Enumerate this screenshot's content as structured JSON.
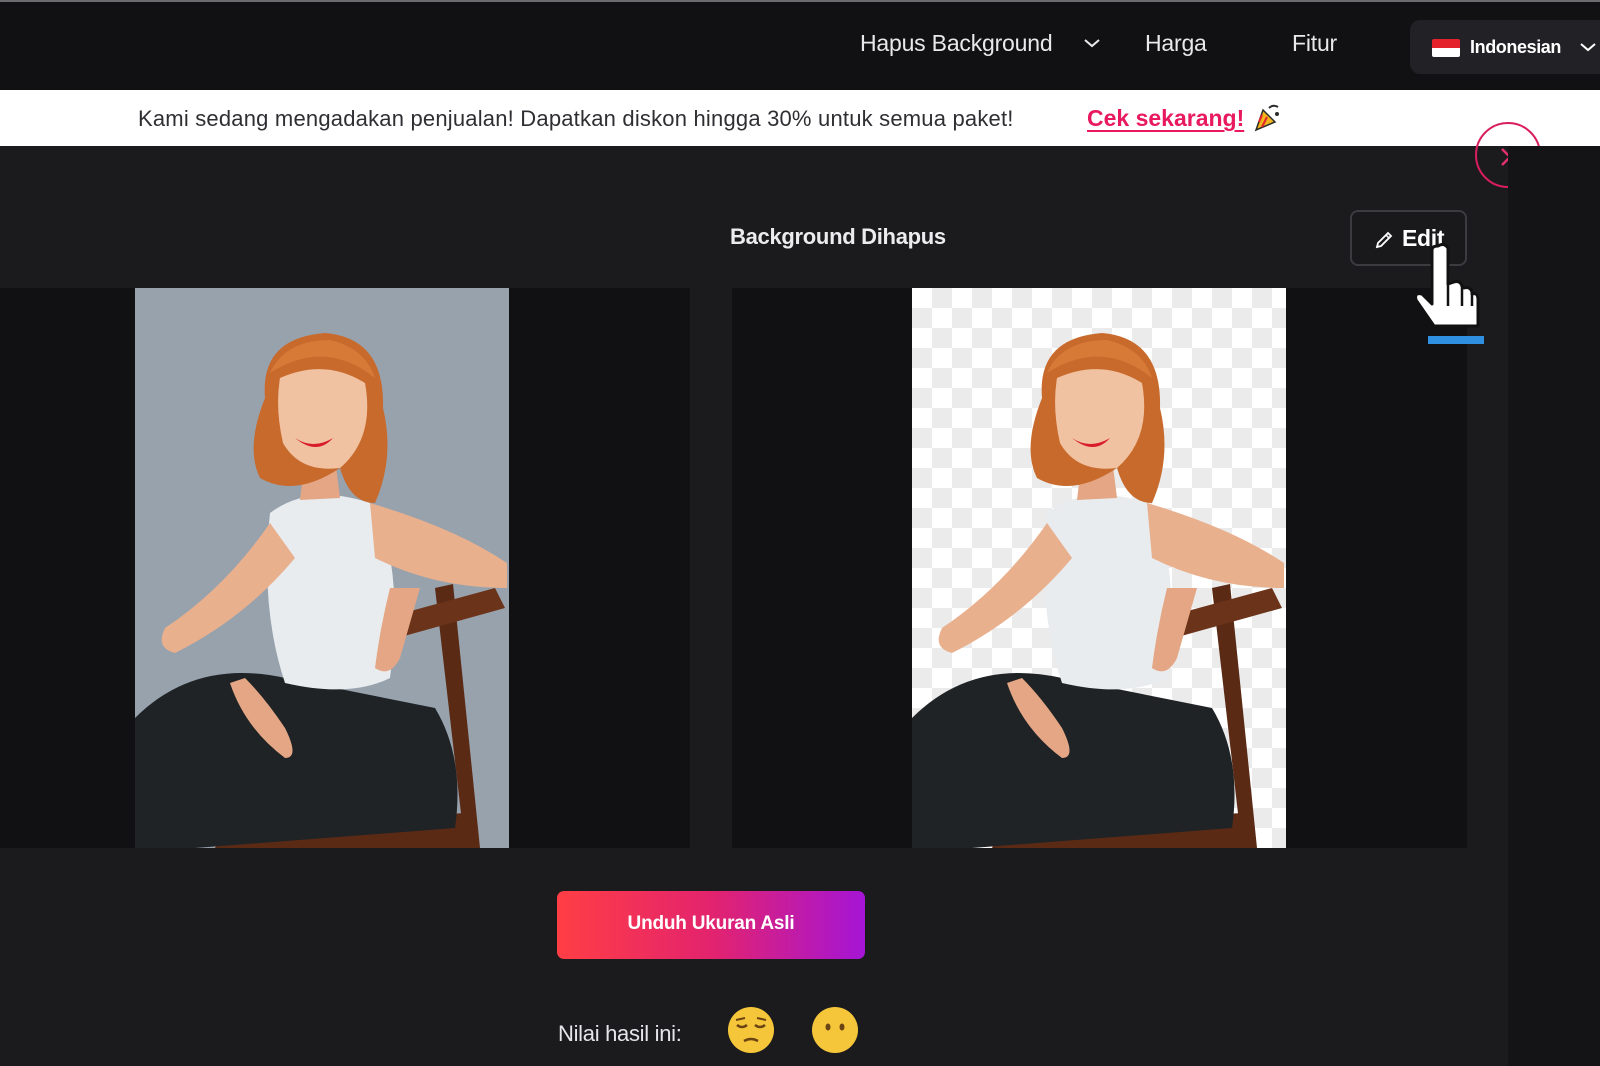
{
  "nav": {
    "remove_bg_label": "Hapus Background",
    "pricing_label": "Harga",
    "features_label": "Fitur",
    "language_label": "Indonesian"
  },
  "banner": {
    "text": "Kami sedang mengadakan penjualan! Dapatkan diskon hingga 30% untuk semua paket!",
    "link_label": "Cek sekarang!"
  },
  "result": {
    "title": "Background Dihapus",
    "edit_label": "Edit"
  },
  "actions": {
    "download_label": "Unduh Ukuran Asli"
  },
  "rating": {
    "label": "Nilai hasil ini:",
    "options": [
      "relieved-face-icon",
      "face-without-mouth-icon"
    ]
  },
  "colors": {
    "accent": "#e8195e",
    "gradient_start": "#ff3e45",
    "gradient_end": "#a515d6",
    "nav_bg": "#111113",
    "page_bg": "#1b1b1e"
  }
}
